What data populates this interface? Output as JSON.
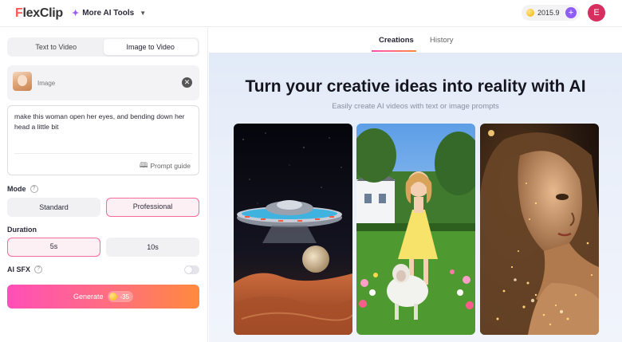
{
  "header": {
    "logo_mark": "F",
    "logo_text": "lexClip",
    "ai_tools_label": "More AI Tools",
    "credits": "2015.9",
    "avatar_initial": "E"
  },
  "left_panel": {
    "tabs": [
      {
        "label": "Text to Video",
        "active": false
      },
      {
        "label": "Image to Video",
        "active": true
      }
    ],
    "image_card": {
      "label": "Image"
    },
    "prompt": {
      "text": "make this woman open her eyes, and bending down her head a little bit",
      "guide_label": "Prompt guide"
    },
    "mode": {
      "label": "Mode",
      "options": [
        {
          "label": "Standard",
          "selected": false
        },
        {
          "label": "Professional",
          "selected": true
        }
      ]
    },
    "duration": {
      "label": "Duration",
      "options": [
        {
          "label": "5s",
          "selected": true
        },
        {
          "label": "10s",
          "selected": false
        }
      ]
    },
    "ai_sfx": {
      "label": "AI SFX",
      "enabled": false
    },
    "generate": {
      "label": "Generate",
      "cost": "-35"
    }
  },
  "right_panel": {
    "tabs": [
      {
        "label": "Creations",
        "active": true
      },
      {
        "label": "History",
        "active": false
      }
    ],
    "headline": "Turn your creative ideas into reality with AI",
    "subline": "Easily create AI videos with text or image prompts",
    "showcase": [
      {
        "icon": "ufo-over-desert-image"
      },
      {
        "icon": "girl-with-lamb-image"
      },
      {
        "icon": "glowing-woman-portrait-image"
      }
    ]
  },
  "colors": {
    "accent_pink": "#f56a9a",
    "generate_start": "#ff4fb8",
    "generate_end": "#ff8a3d",
    "credits_plus": "#8e5cf7",
    "avatar_bg": "#d62f5f"
  }
}
